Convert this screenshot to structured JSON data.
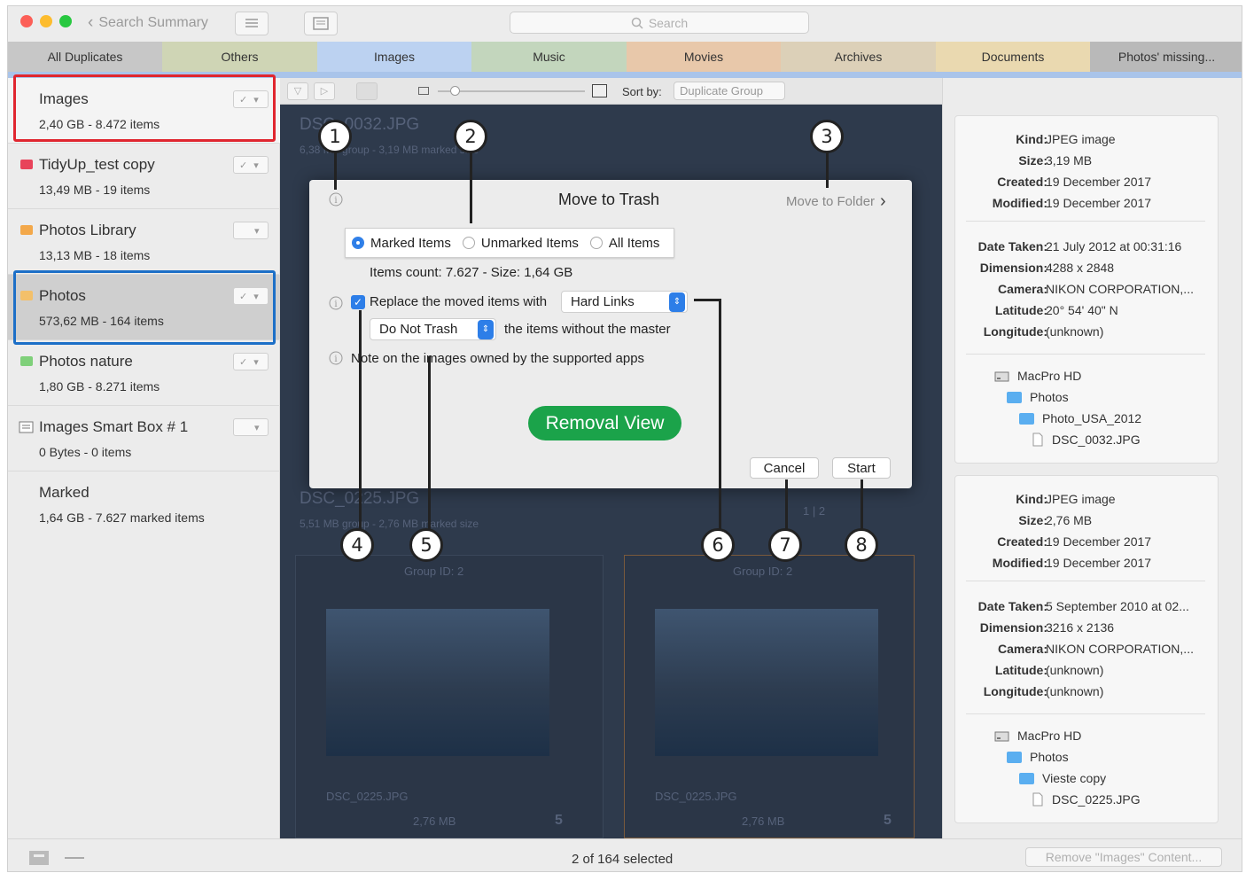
{
  "toolbar": {
    "back_label": "Search Summary",
    "search_placeholder": "Search"
  },
  "tabs": [
    {
      "label": "All Duplicates",
      "color": "#c7c7c7"
    },
    {
      "label": "Others",
      "color": "#cfd5b5"
    },
    {
      "label": "Images",
      "color": "#bcd2f1"
    },
    {
      "label": "Music",
      "color": "#c3d6bd"
    },
    {
      "label": "Movies",
      "color": "#e8c8aa"
    },
    {
      "label": "Archives",
      "color": "#dcd0b8"
    },
    {
      "label": "Documents",
      "color": "#ead9b0"
    },
    {
      "label": "Photos' missing...",
      "color": "#b9b9b9"
    }
  ],
  "sidebar": [
    {
      "name": "Images",
      "sub": "2,40 GB - 8.472 items",
      "icon": "none",
      "checked": true
    },
    {
      "name": "TidyUp_test copy",
      "sub": "13,49 MB - 19 items",
      "icon": "folder-red",
      "checked": true
    },
    {
      "name": "Photos Library",
      "sub": "13,13 MB - 18 items",
      "icon": "folder-orange",
      "checked": false
    },
    {
      "name": "Photos",
      "sub": "573,62 MB - 164 items",
      "icon": "folder-orange",
      "checked": true
    },
    {
      "name": "Photos nature",
      "sub": "1,80 GB - 8.271 items",
      "icon": "folder-green",
      "checked": true
    },
    {
      "name": "Images Smart Box # 1",
      "sub": "0 Bytes - 0 items",
      "icon": "smartbox",
      "checked": false
    },
    {
      "name": "Marked",
      "sub": "1,64 GB - 7.627 marked items",
      "icon": "none",
      "checked": null
    }
  ],
  "subtoolbar": {
    "sort_label": "Sort by:",
    "sort_value": "Duplicate Group"
  },
  "groups": {
    "g1_title": "DSC_0032.JPG",
    "g1_sub": "6,38 MB group - 3,19 MB marked size",
    "g2_title": "DSC_0225.JPG",
    "g2_sub": "5,51 MB group - 2,76 MB marked size",
    "g2_pager": "1 | 2",
    "card1": {
      "group": "Group ID: 2",
      "file": "DSC_0225.JPG",
      "size": "2,76 MB",
      "count": "5"
    },
    "card2": {
      "group": "Group ID: 2",
      "file": "DSC_0225.JPG",
      "size": "2,76 MB",
      "count": "5"
    }
  },
  "dialog": {
    "title": "Move to Trash",
    "move_to_folder": "Move to Folder",
    "radio_marked": "Marked Items",
    "radio_unmarked": "Unmarked Items",
    "radio_all": "All Items",
    "items_count": "Items count: 7.627 - Size: 1,64 GB",
    "replace_label": "Replace the moved items with",
    "replace_value": "Hard Links",
    "trash_value": "Do Not Trash",
    "trash_suffix": "the items without the master",
    "note": "Note on the images owned by the supported apps",
    "removal_view": "Removal View",
    "cancel": "Cancel",
    "start": "Start"
  },
  "callouts": [
    "1",
    "2",
    "3",
    "4",
    "5",
    "6",
    "7",
    "8"
  ],
  "info1": {
    "rows": [
      {
        "k": "Kind:",
        "v": "JPEG image"
      },
      {
        "k": "Size:",
        "v": "3,19 MB"
      },
      {
        "k": "Created:",
        "v": "19 December 2017"
      },
      {
        "k": "Modified:",
        "v": "19 December 2017"
      }
    ],
    "rows2": [
      {
        "k": "Date Taken:",
        "v": "21 July 2012 at 00:31:16"
      },
      {
        "k": "Dimension:",
        "v": "4288 x 2848"
      },
      {
        "k": "Camera:",
        "v": "NIKON CORPORATION,..."
      },
      {
        "k": "Latitude:",
        "v": "20° 54' 40\" N"
      },
      {
        "k": "Longitude:",
        "v": "(unknown)"
      }
    ],
    "path": [
      "MacPro HD",
      "Photos",
      "Photo_USA_2012",
      "DSC_0032.JPG"
    ]
  },
  "info2": {
    "rows": [
      {
        "k": "Kind:",
        "v": "JPEG image"
      },
      {
        "k": "Size:",
        "v": "2,76 MB"
      },
      {
        "k": "Created:",
        "v": "19 December 2017"
      },
      {
        "k": "Modified:",
        "v": "19 December 2017"
      }
    ],
    "rows2": [
      {
        "k": "Date Taken:",
        "v": "5 September 2010 at 02..."
      },
      {
        "k": "Dimension:",
        "v": "3216 x 2136"
      },
      {
        "k": "Camera:",
        "v": "NIKON CORPORATION,..."
      },
      {
        "k": "Latitude:",
        "v": "(unknown)"
      },
      {
        "k": "Longitude:",
        "v": "(unknown)"
      }
    ],
    "path": [
      "MacPro HD",
      "Photos",
      "Vieste copy",
      "DSC_0225.JPG"
    ]
  },
  "status": {
    "selected": "2 of 164 selected",
    "remove_button": "Remove \"Images\" Content..."
  },
  "colors": {
    "highlight_red": "#e0262f",
    "highlight_blue": "#1c6fc7",
    "removal_green": "#1ba34a",
    "accent_blue": "#2d7ee8"
  }
}
